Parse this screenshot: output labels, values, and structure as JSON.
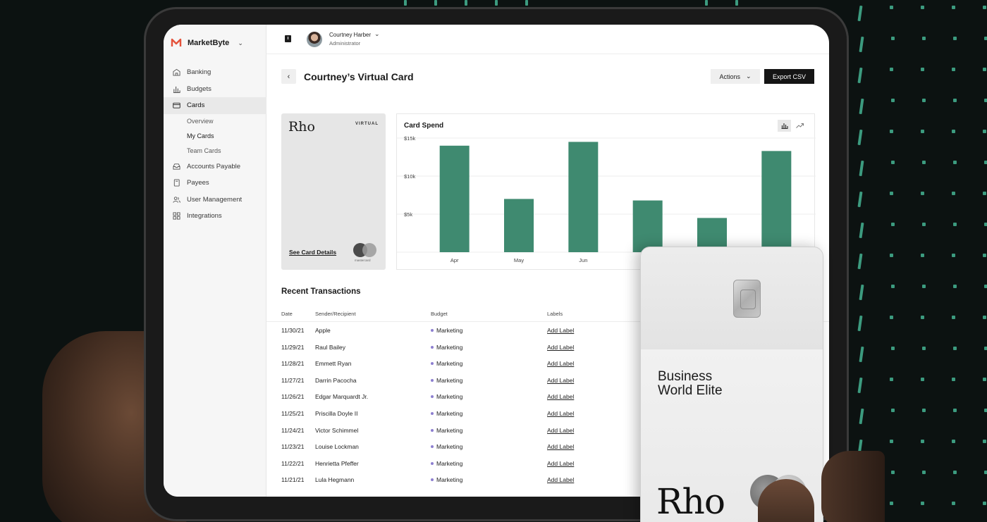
{
  "app": {
    "name": "MarketByte",
    "brand_color": "#e4523b"
  },
  "sidebar": {
    "items": [
      {
        "label": "Banking",
        "icon": "bank-icon"
      },
      {
        "label": "Budgets",
        "icon": "bar-chart-icon"
      },
      {
        "label": "Cards",
        "icon": "credit-card-icon",
        "active": true
      },
      {
        "label": "Accounts Payable",
        "icon": "inbox-icon"
      },
      {
        "label": "Payees",
        "icon": "book-icon"
      },
      {
        "label": "User Management",
        "icon": "users-icon"
      },
      {
        "label": "Integrations",
        "icon": "grid-icon"
      }
    ],
    "sub_items": [
      "Overview",
      "My Cards",
      "Team Cards"
    ]
  },
  "user": {
    "name": "Courtney Harber",
    "role": "Administrator"
  },
  "header": {
    "title": "Courtney’s Virtual Card",
    "actions_label": "Actions",
    "export_label": "Export CSV"
  },
  "mini_card": {
    "brand": "Rho",
    "type": "VIRTUAL",
    "details_link": "See Card Details",
    "network": "mastercard"
  },
  "chart": {
    "title": "Card Spend",
    "accent_color": "#3f8a70"
  },
  "chart_data": {
    "type": "bar",
    "title": "Card Spend",
    "categories": [
      "Apr",
      "May",
      "Jun",
      "",
      "",
      ""
    ],
    "visible_category_labels": [
      "Apr",
      "May",
      "Jun"
    ],
    "values": [
      14000,
      7000,
      14500,
      6800,
      4500,
      13300
    ],
    "ylim": [
      0,
      15000
    ],
    "yticks": [
      "$5k",
      "$10k",
      "$15k"
    ],
    "ytick_values": [
      5000,
      10000,
      15000
    ],
    "grid": true
  },
  "transactions": {
    "title": "Recent Transactions",
    "headers": {
      "date": "Date",
      "sender": "Sender/Recipient",
      "budget": "Budget",
      "labels": "Labels"
    },
    "rows": [
      {
        "date": "11/30/21",
        "name": "Apple",
        "budget": "Marketing",
        "label": "Add Label"
      },
      {
        "date": "11/29/21",
        "name": "Raul Bailey",
        "budget": "Marketing",
        "label": "Add Label"
      },
      {
        "date": "11/28/21",
        "name": "Emmett Ryan",
        "budget": "Marketing",
        "label": "Add Label"
      },
      {
        "date": "11/27/21",
        "name": "Darrin Pacocha",
        "budget": "Marketing",
        "label": "Add Label"
      },
      {
        "date": "11/26/21",
        "name": "Edgar Marquardt Jr.",
        "budget": "Marketing",
        "label": "Add Label"
      },
      {
        "date": "11/25/21",
        "name": "Priscilla Doyle II",
        "budget": "Marketing",
        "label": "Add Label"
      },
      {
        "date": "11/24/21",
        "name": "Victor Schimmel",
        "budget": "Marketing",
        "label": "Add Label"
      },
      {
        "date": "11/23/21",
        "name": "Louise Lockman",
        "budget": "Marketing",
        "label": "Add Label"
      },
      {
        "date": "11/22/21",
        "name": "Henrietta Pfeffer",
        "budget": "Marketing",
        "label": "Add Label"
      },
      {
        "date": "11/21/21",
        "name": "Lula Hegmann",
        "budget": "Marketing",
        "label": "Add Label"
      }
    ]
  },
  "physical_card": {
    "line1": "Business",
    "line2": "World Elite",
    "brand": "Rho"
  }
}
